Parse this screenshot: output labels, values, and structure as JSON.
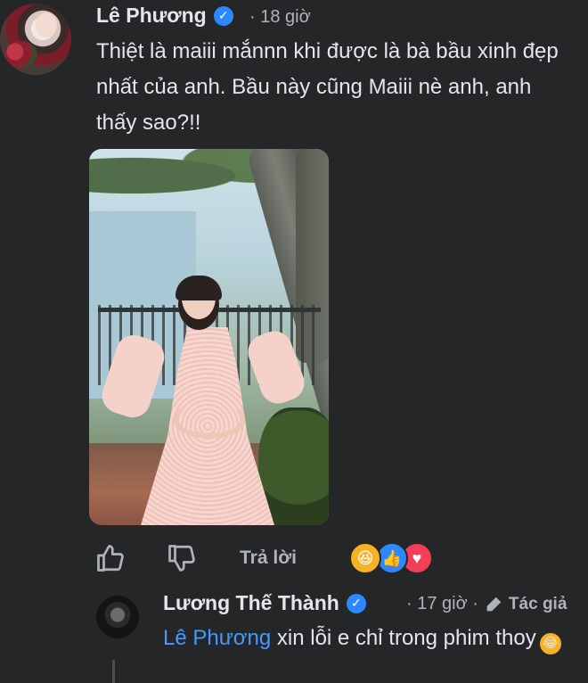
{
  "comment": {
    "author": "Lê Phương",
    "verified_icon": "verified-badge-icon",
    "time": "· 18 giờ",
    "text": "Thiệt là maiii mắnnn khi được là bà bầu xinh đẹp nhất của anh. Bầu này cũng Maiii nè anh, anh thấy sao?!!",
    "photo_alt": "attached-photo",
    "actions": {
      "like_icon": "thumbs-up-icon",
      "dislike_icon": "thumbs-down-icon",
      "reply_label": "Trả lời"
    },
    "reactions": [
      "haha",
      "like",
      "love"
    ]
  },
  "reply": {
    "author": "Lương Thế Thành",
    "verified_icon": "verified-badge-icon",
    "time": "· 17 giờ ·",
    "author_tag": "Tác giả",
    "mention": "Lê Phương",
    "text": " xin lỗi e chỉ trong phim thoy",
    "emoji": "laughing-tears"
  },
  "colors": {
    "background": "#252628",
    "primary_text": "#e4e6eb",
    "secondary_text": "#b0b3b8",
    "accent_blue": "#2d88ff",
    "mention_blue": "#4599ff"
  }
}
